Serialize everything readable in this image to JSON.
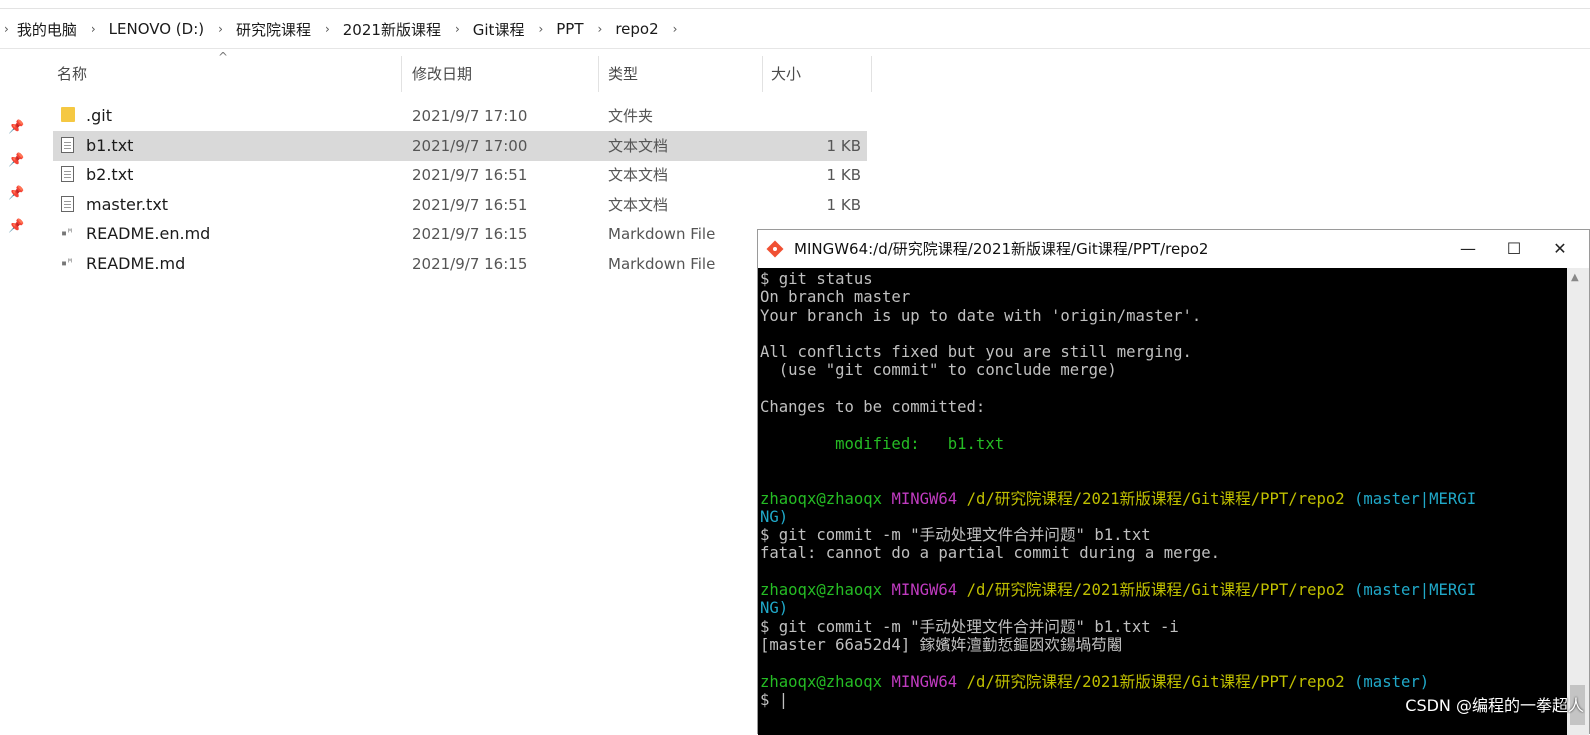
{
  "breadcrumb": {
    "items": [
      "我的电脑",
      "LENOVO (D:)",
      "研究院课程",
      "2021新版课程",
      "Git课程",
      "PPT",
      "repo2"
    ]
  },
  "columns": {
    "name": "名称",
    "date": "修改日期",
    "type": "类型",
    "size": "大小"
  },
  "files": [
    {
      "name": ".git",
      "date": "2021/9/7 17:10",
      "type": "文件夹",
      "size": "",
      "icon": "folder-icon"
    },
    {
      "name": "b1.txt",
      "date": "2021/9/7 17:00",
      "type": "文本文档",
      "size": "1 KB",
      "icon": "text-file-icon",
      "selected": true
    },
    {
      "name": "b2.txt",
      "date": "2021/9/7 16:51",
      "type": "文本文档",
      "size": "1 KB",
      "icon": "text-file-icon"
    },
    {
      "name": "master.txt",
      "date": "2021/9/7 16:51",
      "type": "文本文档",
      "size": "1 KB",
      "icon": "text-file-icon"
    },
    {
      "name": "README.en.md",
      "date": "2021/9/7 16:15",
      "type": "Markdown File",
      "size": "",
      "icon": "markdown-file-icon"
    },
    {
      "name": "README.md",
      "date": "2021/9/7 16:15",
      "type": "Markdown File",
      "size": "",
      "icon": "markdown-file-icon"
    }
  ],
  "terminal": {
    "title": "MINGW64:/d/研究院课程/2021新版课程/Git课程/PPT/repo2",
    "controls": {
      "minimize": "—",
      "maximize": "☐",
      "close": "✕"
    },
    "lines": [
      "$ git status",
      "On branch master",
      "Your branch is up to date with 'origin/master'.",
      "",
      "All conflicts fixed but you are still merging.",
      "  (use \"git commit\" to conclude merge)",
      "",
      "Changes to be committed:",
      "",
      "        modified:   b1.txt",
      "",
      "",
      "zhaoqx@zhaoqx MINGW64 /d/研究院课程/2021新版课程/Git课程/PPT/repo2 (master|MERGI",
      "NG)",
      "$ git commit -m \"手动处理文件合并问题\" b1.txt",
      "fatal: cannot do a partial commit during a merge.",
      "",
      "zhaoqx@zhaoqx MINGW64 /d/研究院课程/2021新版课程/Git课程/PPT/repo2 (master|MERGI",
      "NG)",
      "$ git commit -m \"手动处理文件合并问题\" b1.txt -i",
      "[master 66a52d4] 鎵嬪姩澶勭悊鏂囦欢鍚堝苟闂",
      "",
      "zhaoqx@zhaoqx MINGW64 /d/研究院课程/2021新版课程/Git课程/PPT/repo2 (master)",
      "$ |"
    ],
    "colors": {
      "background": "#000000",
      "text": "#c0c0c0",
      "green": "#25bc24",
      "yellow": "#bfbf00",
      "magenta": "#c03bc0",
      "cyan": "#20a9c9"
    }
  },
  "watermark": "CSDN @编程的一拳超人"
}
